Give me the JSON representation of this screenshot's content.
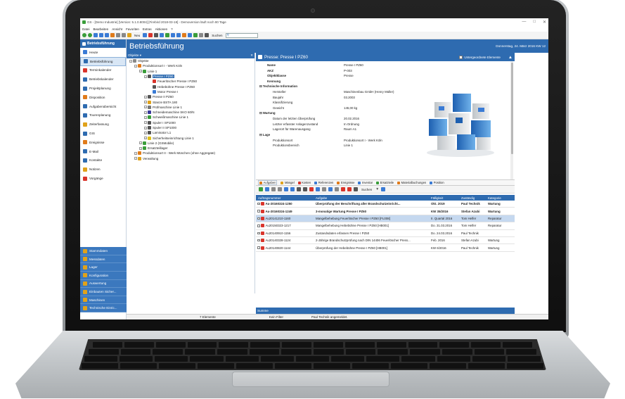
{
  "window": {
    "title": "GS - [Demo Industrie] [Version: 5.1.0.8004] [Firebird 2018-03-18] - Demoversion läuft noch 80 Tage",
    "controls": [
      "—",
      "□",
      "✕"
    ]
  },
  "menu": [
    "Datei",
    "Bearbeiten",
    "Ansicht",
    "Favoriten",
    "Extras",
    "Aktionen",
    "?"
  ],
  "toolbar": {
    "new_label": "Neu",
    "search_label": "Suchen",
    "search_value": ""
  },
  "sidebar": {
    "header": "Betriebsführung",
    "items": [
      {
        "label": "Heute",
        "color": "#3a7bd5"
      },
      {
        "label": "Betriebsführung",
        "color": "#2e6bb0",
        "active": true
      },
      {
        "label": "Terminkalender",
        "color": "#d9342b"
      },
      {
        "label": "Betriebskalender",
        "color": "#2e6bb0"
      },
      {
        "label": "Projektplanung",
        "color": "#2e6bb0"
      },
      {
        "label": "Disposition",
        "color": "#e07b1a"
      },
      {
        "label": "Aufgabenübersicht",
        "color": "#2e6bb0"
      },
      {
        "label": "Tourenplanung",
        "color": "#2e6bb0"
      },
      {
        "label": "Zeiterfassung",
        "color": "#e0a21a"
      },
      {
        "label": "GIS",
        "color": "#2e6bb0"
      },
      {
        "label": "Ereignisse",
        "color": "#e07b1a"
      },
      {
        "label": "E-Mail",
        "color": "#2e6bb0"
      },
      {
        "label": "Kontakte",
        "color": "#2e6bb0"
      },
      {
        "label": "Notizen",
        "color": "#e0a21a"
      },
      {
        "label": "Vorgänge",
        "color": "#d9342b"
      }
    ],
    "bottom_items": [
      "Stammdaten",
      "Messdaten",
      "Lager",
      "Konfiguration",
      "Auswertung",
      "Einbauten Sicher...",
      "Maschinen",
      "Technische Einric..."
    ]
  },
  "page": {
    "title": "Betriebsführung",
    "date": "Donnerstag, 24. März 2016  KW 12"
  },
  "tree": {
    "header": "Objekte ▾",
    "nodes": [
      {
        "label": "Objekte",
        "level": 0,
        "color": "#888"
      },
      {
        "label": "Produktionsort I - Werk Köln",
        "level": 1,
        "color": "#e07b1a"
      },
      {
        "label": "Linie 1",
        "level": 2,
        "color": "#3a9d3a"
      },
      {
        "label": "Presse I PZ60",
        "level": 3,
        "color": "#555",
        "selected": true
      },
      {
        "label": "Feuerlöscher Presse I PZ60",
        "level": 4,
        "color": "#d9342b"
      },
      {
        "label": "Hebebühne Presse I PZ60",
        "level": 4,
        "color": "#555"
      },
      {
        "label": "Motor Presse I",
        "level": 4,
        "color": "#3a7bd5"
      },
      {
        "label": "Presse II PZ60",
        "level": 3,
        "color": "#555"
      },
      {
        "label": "Stanze BSTA 180",
        "level": 3,
        "color": "#e0a21a"
      },
      {
        "label": "Prüfmaschine Linie 1",
        "level": 3,
        "color": "#777"
      },
      {
        "label": "Schneidemaschine SKO 60/N",
        "level": 3,
        "color": "#3a3a9d"
      },
      {
        "label": "Schweißmaschine Linie 1",
        "level": 3,
        "color": "#3a9d3a"
      },
      {
        "label": "Spuler I SP1000",
        "level": 3,
        "color": "#555"
      },
      {
        "label": "Spuler II SP1000",
        "level": 3,
        "color": "#555"
      },
      {
        "label": "Laminator L1",
        "level": 3,
        "color": "#555"
      },
      {
        "label": "Sicherheitseinrichtung Linie 1",
        "level": 3,
        "color": "#e0c21a"
      },
      {
        "label": "Linie 2 (GSMobile)",
        "level": 2,
        "color": "#3a9d3a"
      },
      {
        "label": "Ersatzteillager",
        "level": 2,
        "color": "#3a9d3a"
      },
      {
        "label": "Produktionsort II - Werk München (ohne Aggregate)",
        "level": 1,
        "color": "#e07b1a"
      },
      {
        "label": "Verwaltung",
        "level": 1,
        "color": "#e0a21a"
      }
    ]
  },
  "detail": {
    "title": "Presse: Presse I PZ60",
    "checkbox_label": "Untergeordnete Elemente",
    "rows": [
      {
        "k": "Name",
        "v": "Presse I PZ60",
        "t": "field"
      },
      {
        "k": "AKZ",
        "v": "P-003",
        "t": "field"
      },
      {
        "k": "Objektklasse",
        "v": "Presse",
        "t": "field"
      },
      {
        "k": "Kennung",
        "v": "",
        "t": "field"
      },
      {
        "k": "⊟ Technische Information",
        "v": "",
        "t": "sec"
      },
      {
        "k": "Hersteller",
        "v": "Maschinenbau GmbH (Henry Müller)",
        "t": "sub"
      },
      {
        "k": "Baujahr",
        "v": "03.2003",
        "t": "sub"
      },
      {
        "k": "Klassifizierung",
        "v": "",
        "t": "sub"
      },
      {
        "k": "Gewicht",
        "v": "145,00 kg",
        "t": "sub"
      },
      {
        "k": "⊟ Wartung",
        "v": "",
        "t": "sec"
      },
      {
        "k": "Datum der letzten Überprüfung",
        "v": "20.02.2016",
        "t": "sub"
      },
      {
        "k": "Letzter erfasster Anlagenzustand",
        "v": "In Ordnung",
        "t": "sub"
      },
      {
        "k": "Lagerort für Warenausgang",
        "v": "Raum A1",
        "t": "sub"
      },
      {
        "k": "⊟ Lage",
        "v": "",
        "t": "sec"
      },
      {
        "k": "Produktionsort",
        "v": "Produktionsort I - Werk Köln",
        "t": "sub"
      },
      {
        "k": "Produktionsbereich",
        "v": "Linie 1",
        "t": "sub"
      }
    ]
  },
  "tabs": [
    {
      "label": "Aufgaben",
      "color": "#e07b1a",
      "active": true
    },
    {
      "label": "Mängel",
      "color": "#e0a21a"
    },
    {
      "label": "Kosten",
      "color": "#d9342b"
    },
    {
      "label": "Referenzen",
      "color": "#3a7bd5"
    },
    {
      "label": "Ereignisse",
      "color": "#e07b1a"
    },
    {
      "label": "Inventar",
      "color": "#3a7bd5"
    },
    {
      "label": "Ersatzteile",
      "color": "#3a9d3a"
    },
    {
      "label": "Materialbuchungen",
      "color": "#e07b1a"
    },
    {
      "label": "Position",
      "color": "#3a7bd5"
    }
  ],
  "grid": {
    "search_label": "Suchen",
    "columns": [
      "Auftragsnummer",
      "Aufgabe",
      "Fälligkeit",
      "Zuständig",
      "Kategorie"
    ],
    "rows": [
      {
        "cells": [
          "Au-20160324-1250",
          "Überprüfung der Beschriftung aller Brandschutzeinricht...",
          "Okt. 2019",
          "Paul Technik",
          "Wartung"
        ],
        "bold": true
      },
      {
        "cells": [
          "Au-20160324-1249",
          "3-monatige Wartung Presse I PZ60",
          "KW 35/2016",
          "Stefan Azubi",
          "Wartung"
        ],
        "bold": true
      },
      {
        "cells": [
          "Au20141210-1160",
          "Mangelbehebung Feuerlöscher Presse I PZ60 [FL008]",
          "II. Quartal 2016",
          "Tom Helfer",
          "Reparatur"
        ],
        "selected": true
      },
      {
        "cells": [
          "Au20150323-1217",
          "Mangelbehebung Hebebühne Presse I PZ60 [HB001]",
          "Do. 31.03.2016",
          "Tom Helfer",
          "Reparatur"
        ]
      },
      {
        "cells": [
          "Au20140910-1156",
          "Zustandsdaten erfassen Presse I PZ60",
          "Do. 24.03.2016",
          "Paul Technik",
          ""
        ]
      },
      {
        "cells": [
          "Au20140328-1124",
          "2-Jährige Brandschutzprüfung nach DIN 14406 Feuerlöscher Press...",
          "Feb. 2016",
          "Stefan Azubi",
          "Wartung"
        ]
      },
      {
        "cells": [
          "Au20140820-1144",
          "Überprüfung der Hebebühne Presse I PZ60 [HB001]",
          "KW 6/2016",
          "Paul Technik",
          "Wartung"
        ]
      }
    ],
    "summary_label": "Summe"
  },
  "status": {
    "count": "7 Elemente",
    "filter": "Kein Filter",
    "user": "Paul Technik angemeldet."
  }
}
